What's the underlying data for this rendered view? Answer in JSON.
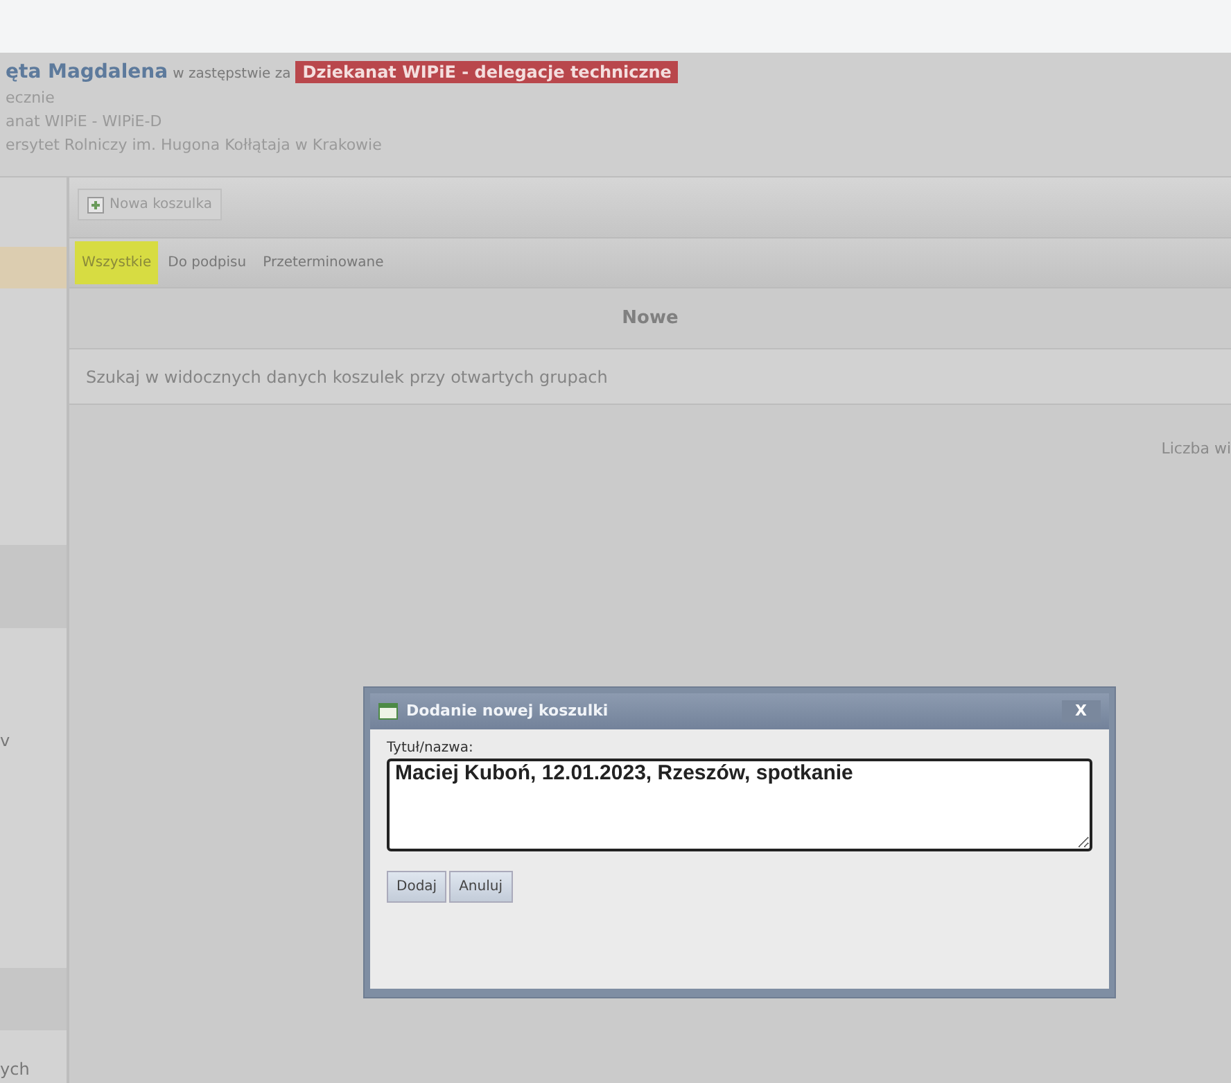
{
  "header": {
    "user_name": "ęta Magdalena",
    "substitute_text": "w zastępstwie za",
    "unit_badge": "Dziekanat WIPiE - delegacje techniczne",
    "lines": [
      "ecznie",
      "anat WIPiE - WIPiE-D",
      "ersytet Rolniczy im. Hugona Kołłątaja w Krakowie"
    ]
  },
  "sidebar": {
    "items": [
      {
        "selected": true
      },
      {
        "label": "v",
        "selected": false
      },
      {
        "label": "ych",
        "selected": false
      }
    ]
  },
  "toolbar": {
    "buttons": [
      "Nowa koszulka"
    ]
  },
  "tabs": [
    {
      "label": "Wszystkie",
      "selected": true
    },
    {
      "label": "Do podpisu",
      "selected": false
    },
    {
      "label": "Przeterminowane",
      "selected": false
    }
  ],
  "section_title": "Nowe",
  "search": {
    "placeholder": "Szukaj w widocznych danych koszulek przy otwartych grupach"
  },
  "count_label": "Liczba wi",
  "dialog": {
    "title": "Dodanie nowej koszulki",
    "close": "X",
    "field_label": "Tytuł/nazwa:",
    "field_value": "Maciej Kuboń, 12.01.2023, Rzeszów, spotkanie",
    "buttons": [
      "Dodaj",
      "Anuluj"
    ]
  }
}
